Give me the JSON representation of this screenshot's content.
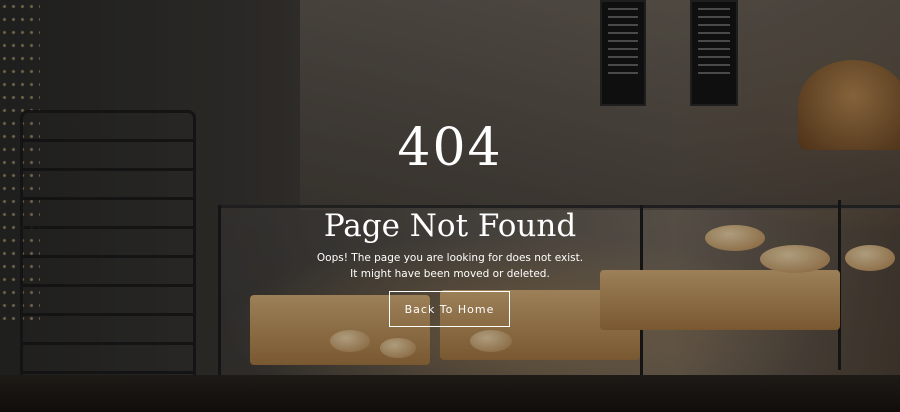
{
  "page": {
    "error_code": "404",
    "title": "Page Not Found",
    "message_line1": "Oops! The page you are looking for does not exist.",
    "message_line2": "It might have been moved or deleted.",
    "button_label": "Back To Home"
  },
  "theme": {
    "text_color": "#ffffff",
    "button_border_color": "#ffffff"
  },
  "background": {
    "description_icon": "bakery-background-image"
  }
}
